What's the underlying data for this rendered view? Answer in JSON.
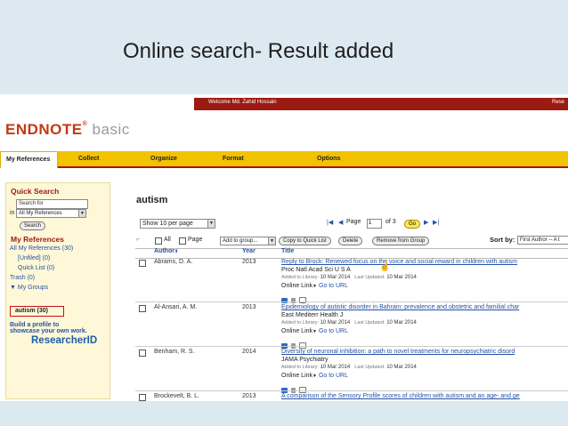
{
  "slide": {
    "title": "Online search- Result added"
  },
  "top_bar": {
    "welcome": "Welcome Md. Zahid Hossain",
    "right_link": "Rese"
  },
  "logo": {
    "name": "ENDNOTE",
    "reg": "®",
    "suffix": "basic"
  },
  "tabs": [
    "My References",
    "Collect",
    "Organize",
    "Format",
    "Options"
  ],
  "sidebar": {
    "quick_search_heading": "Quick Search",
    "search_placeholder": "Search for",
    "in_label": "in",
    "scope_value": "All My References",
    "search_button": "Search",
    "my_references_heading": "My References",
    "items": {
      "all": "All My References (30)",
      "unfiled": "[Unfiled] (0)",
      "quick_list": "Quick List (0)",
      "trash": "Trash (0)",
      "my_groups": "▼ My Groups",
      "autism": "autism  (30)"
    },
    "promo": {
      "line1": "Build a profile to",
      "line2": "showcase your own work.",
      "brand": "ResearcherID"
    }
  },
  "main": {
    "group_title": "autism",
    "show_select": "Show 10 per page",
    "page_label": "Page",
    "page_value": "1",
    "of_label": "of 3",
    "go_button": "Go",
    "select_all": "All",
    "select_page": "Page",
    "add_to_group": "Add to group...",
    "copy_quick_list": "Copy to Quick List",
    "delete": "Delete",
    "remove_from_group": "Remove from Group",
    "sort_label": "Sort by:",
    "sort_value": "First Author -- A t",
    "columns": {
      "author": "Author",
      "year": "Year",
      "title": "Title"
    },
    "rows": [
      {
        "author": "Abrams, D. A.",
        "year": "2013",
        "title": "Reply to Brock: Renewed focus on the voice and social reward in children with autism",
        "journal": "Proc Natl Acad Sci U S A",
        "added_label": "Added to Library:",
        "added": "10 Mar 2014",
        "updated_label": "Last Updated:",
        "updated": "10 Mar 2014",
        "online_link": "Online Link",
        "go_to_url": "Go to URL"
      },
      {
        "author": "Al-Ansari, A. M.",
        "year": "2013",
        "title": "Epidemiology of autistic disorder in Bahrain: prevalence and obstetric and familial char",
        "journal": "East Mediterr Health J",
        "added_label": "Added to Library:",
        "added": "10 Mar 2014",
        "updated_label": "Last Updated:",
        "updated": "10 Mar 2014",
        "online_link": "Online Link",
        "go_to_url": "Go to URL"
      },
      {
        "author": "Benham, R. S.",
        "year": "2014",
        "title": "Diversity of neuronal inhibition: a path to novel treatments for neuropsychiatric disord",
        "journal": "JAMA Psychiatry",
        "added_label": "Added to Library:",
        "added": "10 Mar 2014",
        "updated_label": "Last Updated:",
        "updated": "10 Mar 2014",
        "online_link": "Online Link",
        "go_to_url": "Go to URL"
      },
      {
        "author": "Brockevelt, B. L.",
        "year": "2013",
        "title": "A comparison of the Sensory Profile scores of children with autism and an age- and ge"
      }
    ]
  },
  "colors": {
    "brand_red": "#9b1b13",
    "tab_yellow": "#f3c200",
    "link_blue": "#2451a6"
  }
}
